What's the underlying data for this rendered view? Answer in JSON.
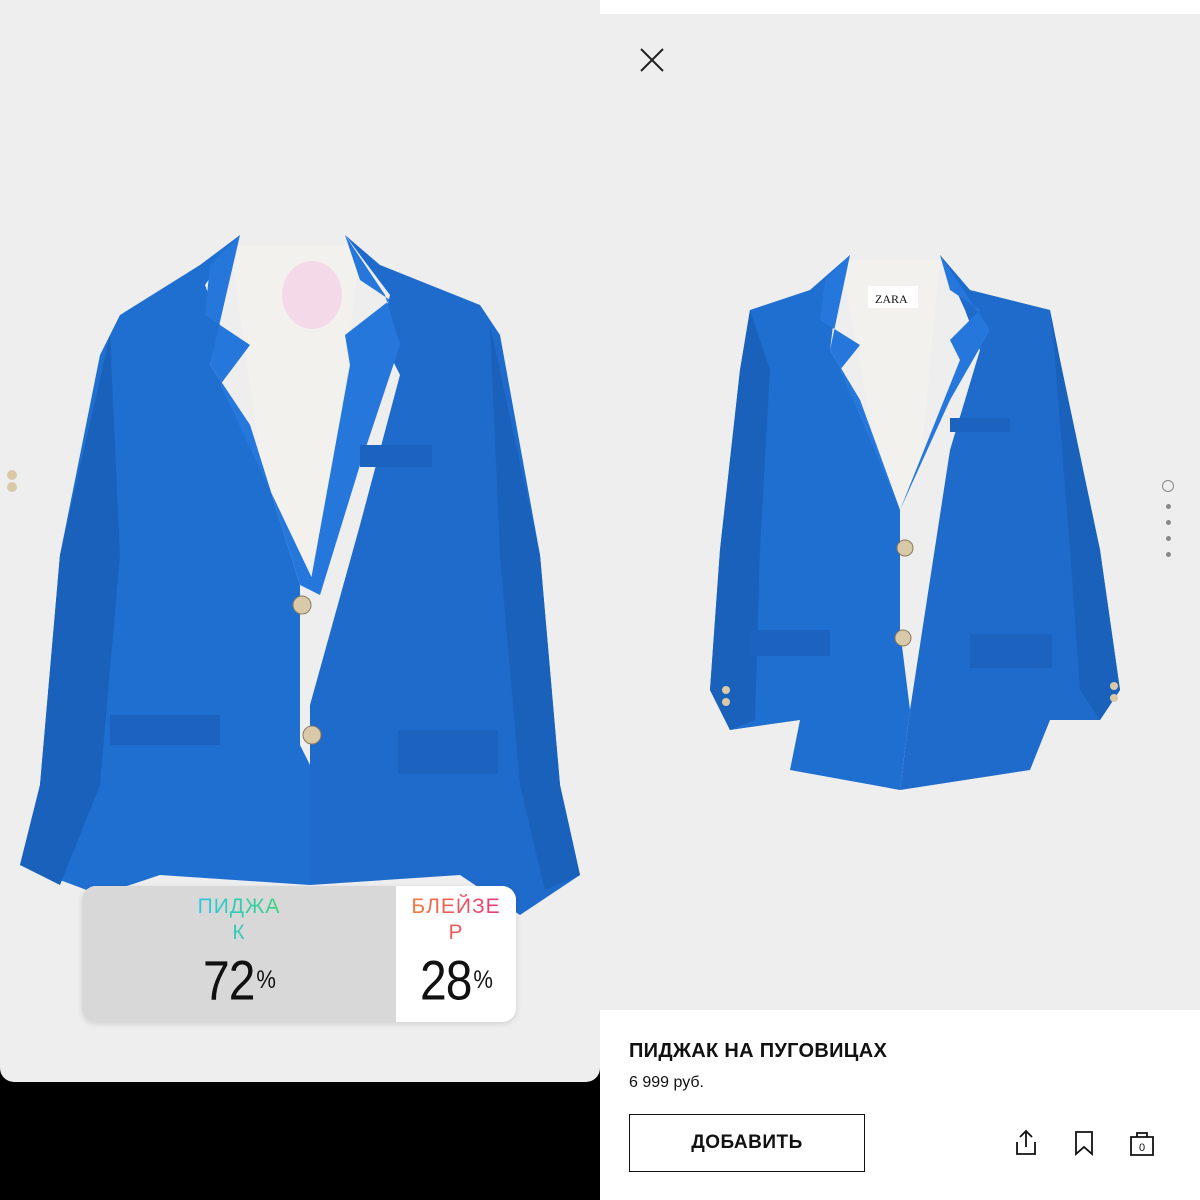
{
  "poll": {
    "option_a": {
      "label": "ПИДЖАК",
      "percent": "72",
      "percent_sign": "%"
    },
    "option_b": {
      "label": "БЛЕЙЗЕР",
      "percent": "28",
      "percent_sign": "%"
    }
  },
  "product": {
    "title": "ПИДЖАК НА ПУГОВИЦАХ",
    "price": "6 999 руб.",
    "add_button": "ДОБАВИТЬ",
    "cart_count": "0",
    "brand_tag": "ZARA"
  },
  "gallery": {
    "total_images": 5,
    "current_index": 1
  },
  "icons": {
    "close": "close-icon",
    "share": "share-icon",
    "bookmark": "bookmark-icon",
    "cart": "shopping-bag-icon"
  },
  "colors": {
    "jacket_blue": "#1f6fd1",
    "background_gray": "#eeeeef",
    "poll_a_gradient": [
      "#2fc7e8",
      "#3ad27a"
    ],
    "poll_b_gradient": [
      "#f57a3d",
      "#e5397a"
    ]
  }
}
